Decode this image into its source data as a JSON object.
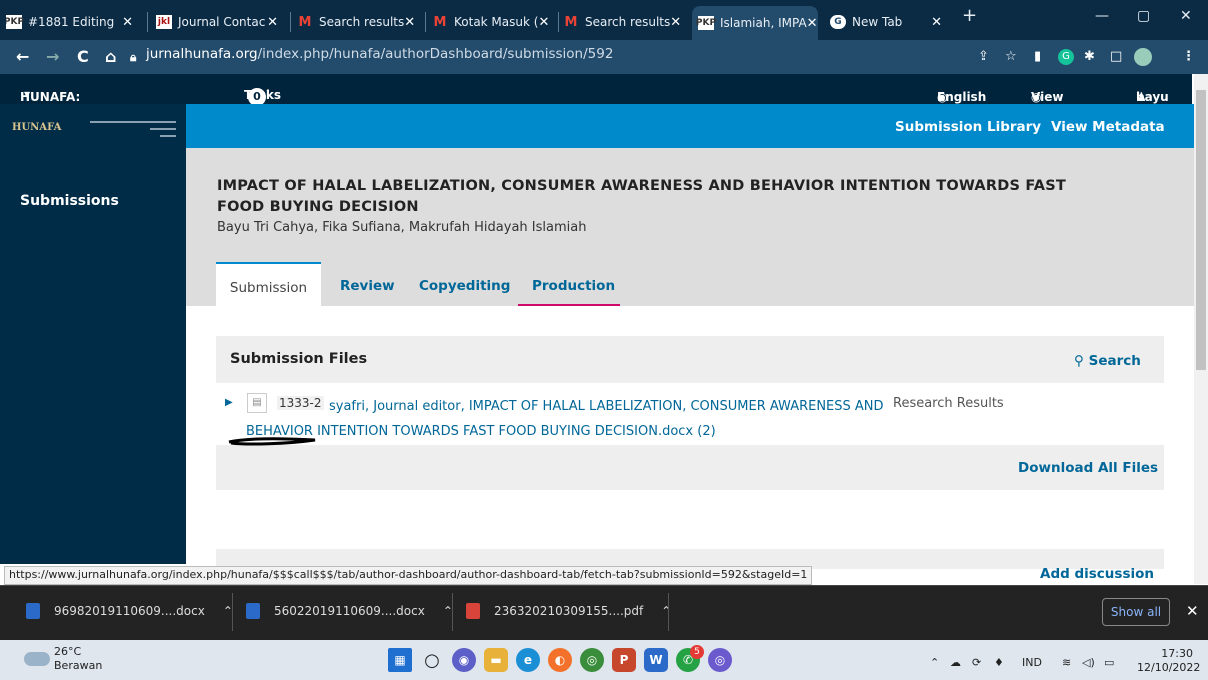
{
  "browser": {
    "tabs": [
      {
        "label": "#1881 Editing",
        "fav": "PKP"
      },
      {
        "label": "Journal Contac",
        "fav": "jkl"
      },
      {
        "label": "Search results",
        "fav": "M"
      },
      {
        "label": "Kotak Masuk (",
        "fav": "M"
      },
      {
        "label": "Search results",
        "fav": "M"
      },
      {
        "label": "Islamiah, IMPA",
        "fav": "PKP"
      },
      {
        "label": "New Tab",
        "fav": "G"
      }
    ],
    "url_domain": "jurnalhunafa.org",
    "url_path": "/index.php/hunafa/authorDashboard/submission/592"
  },
  "ojs_bar": {
    "journal": "HUNAFA: Jurnal Studia Islamika",
    "journal_caret": "▼",
    "tasks_label": "Tasks",
    "tasks_count": "0",
    "language": "English",
    "view_site": "View Site",
    "user": "bayu"
  },
  "sidebar": {
    "logo": "HUNAFA",
    "submissions": "Submissions"
  },
  "header": {
    "submission_library": "Submission Library",
    "view_metadata": "View Metadata"
  },
  "submission": {
    "title": "IMPACT OF HALAL LABELIZATION, CONSUMER AWARENESS AND BEHAVIOR INTENTION TOWARDS FAST FOOD BUYING DECISION",
    "authors": "Bayu Tri Cahya, Fika Sufiana, Makrufah Hidayah Islamiah"
  },
  "workflow_tabs": [
    "Submission",
    "Review",
    "Copyediting",
    "Production"
  ],
  "files_panel": {
    "title": "Submission Files",
    "search": "Search",
    "file_id": "1333-2",
    "file_name": "syafri, Journal editor, IMPACT OF HALAL LABELIZATION, CONSUMER AWARENESS AND BEHAVIOR INTENTION TOWARDS FAST FOOD BUYING DECISION.docx (2)",
    "file_type": "Research Results",
    "download_all": "Download All Files"
  },
  "discussion": {
    "add": "Add discussion"
  },
  "status_url": "https://www.jurnalhunafa.org/index.php/hunafa/$$$call$$$/tab/author-dashboard/author-dashboard-tab/fetch-tab?submissionId=592&stageId=1",
  "downloads": [
    {
      "name": "96982019110609....docx",
      "color": "#2b6ac9"
    },
    {
      "name": "56022019110609....docx",
      "color": "#2b6ac9"
    },
    {
      "name": "236320210309155....pdf",
      "color": "#d9443a"
    }
  ],
  "show_all": "Show all",
  "taskbar": {
    "temp": "26°C",
    "weather": "Berawan",
    "lang": "IND",
    "time": "17:30",
    "date": "12/10/2022",
    "notif_badge": "5"
  }
}
